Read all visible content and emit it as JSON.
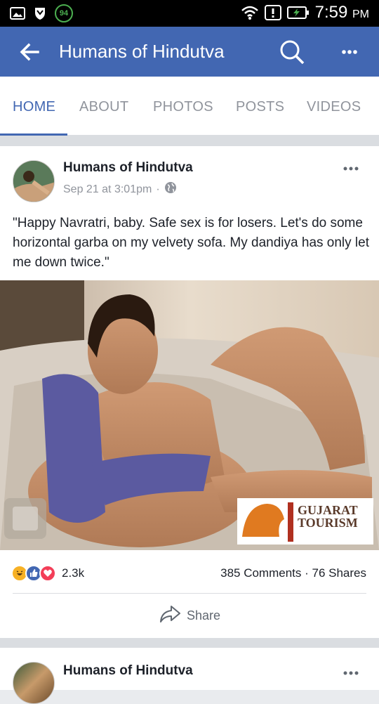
{
  "statusbar": {
    "battery_saver_badge": "94",
    "time": "7:59",
    "time_suffix": "PM",
    "icons": [
      "gallery-icon",
      "shield-icon",
      "wifi-icon",
      "alert-icon",
      "battery-charging-icon"
    ]
  },
  "appbar": {
    "title": "Humans of Hindutva",
    "back_icon": "arrow-left-icon",
    "search_icon": "search-icon",
    "more_icon": "more-horizontal-icon",
    "color": "#4267b2"
  },
  "tabs": [
    {
      "label": "HOME",
      "active": true
    },
    {
      "label": "ABOUT",
      "active": false
    },
    {
      "label": "PHOTOS",
      "active": false
    },
    {
      "label": "POSTS",
      "active": false
    },
    {
      "label": "VIDEOS",
      "active": false
    }
  ],
  "post": {
    "author": "Humans of Hindutva",
    "date": "Sep 21 at 3:01pm",
    "separator": "·",
    "privacy_icon": "globe-icon",
    "text": "\"Happy Navratri, baby. Safe sex is for losers. Let's do some horizontal garba on my velvety sofa. My dandiya has only let me down twice.\"",
    "image_watermark": {
      "line1": "GUJARAT",
      "line2": "TOURISM",
      "logo": "lion-logo"
    },
    "reactions": {
      "icons": [
        "haha-icon",
        "like-icon",
        "love-icon"
      ],
      "count": "2.3k"
    },
    "stats": "385 Comments · 76 Shares",
    "share_label": "Share",
    "share_icon": "share-arrow-icon"
  },
  "next_post": {
    "author": "Humans of Hindutva"
  }
}
